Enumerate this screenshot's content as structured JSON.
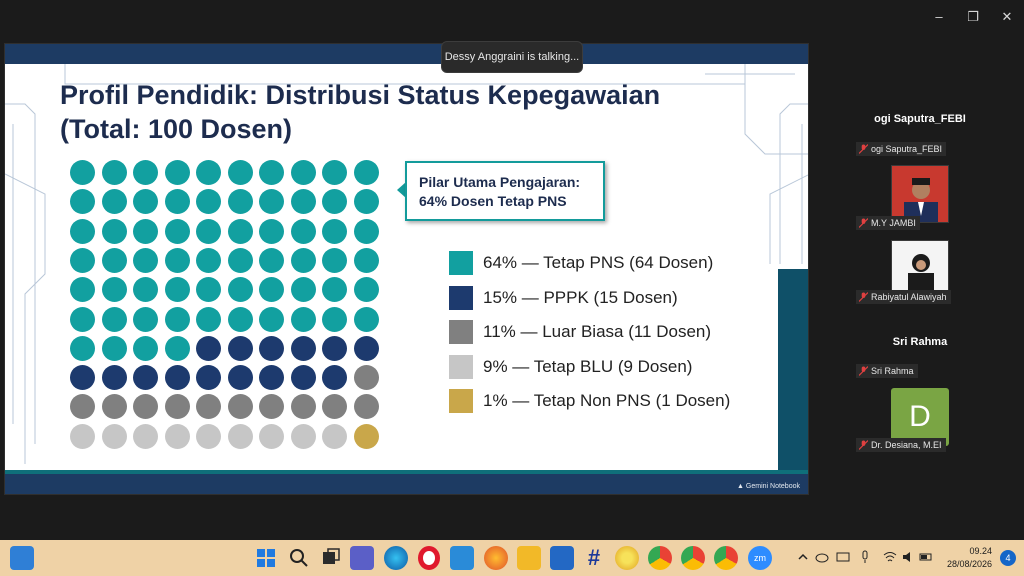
{
  "talking_banner": "Dessy Anggraini is talking...",
  "window_controls": {
    "minimize": "–",
    "restore": "❐",
    "close": "✕"
  },
  "slide": {
    "title_line1": "Profil Pendidik: Distribusi Status Kepegawaian",
    "title_line2": "(Total: 100 Dosen)",
    "callout_line1": "Pilar Utama Pengajaran:",
    "callout_line2": "64% Dosen Tetap PNS",
    "footer_brand": "Gemini Notebook",
    "legend": [
      {
        "label": "64% — Tetap PNS (64 Dosen)",
        "color": "#12a0a0",
        "count": 64
      },
      {
        "label": "15% — PPPK (15 Dosen)",
        "color": "#1d3a6e",
        "count": 15
      },
      {
        "label": "11% — Luar Biasa (11 Dosen)",
        "color": "#808080",
        "count": 11
      },
      {
        "label": "9% — Tetap BLU (9 Dosen)",
        "color": "#c6c6c6",
        "count": 9
      },
      {
        "label": "1% — Tetap Non PNS (1 Dosen)",
        "color": "#c9a74a",
        "count": 1
      }
    ]
  },
  "participants": {
    "heading1": "ogi Saputra_FEBI",
    "heading2": "Sri Rahma",
    "tags": [
      "ogi Saputra_FEBI",
      "M.Y JAMBI",
      "Rabiyatul Alawiyah",
      "Sri Rahma",
      "Dr. Desiana, M.EI"
    ],
    "avatar_letter": "D"
  },
  "taskbar": {
    "time": "09.24",
    "date": "28/08/2026",
    "notification_count": "4",
    "zoom_label": "zm",
    "apps": [
      "file-explorer-widget",
      "windows-start",
      "search",
      "task-view",
      "teams",
      "edge",
      "opera",
      "store",
      "firefox",
      "files",
      "word",
      "notepad",
      "chrome-canary",
      "chrome",
      "chrome-profile2",
      "chrome-profile3",
      "zoom"
    ]
  }
}
